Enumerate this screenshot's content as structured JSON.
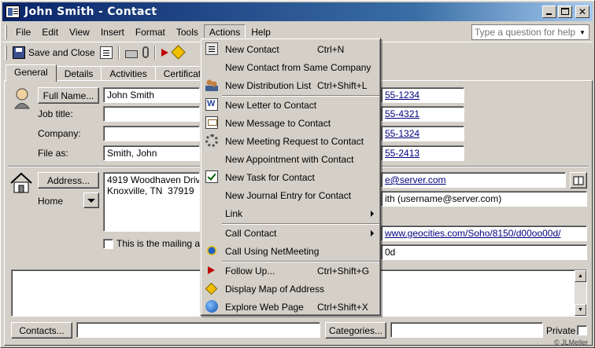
{
  "window": {
    "title": "John Smith - Contact"
  },
  "menubar": {
    "items": [
      "File",
      "Edit",
      "View",
      "Insert",
      "Format",
      "Tools",
      "Actions",
      "Help"
    ],
    "question_placeholder": "Type a question for help"
  },
  "toolbar": {
    "save_close_label": "Save and Close"
  },
  "tabs": [
    "General",
    "Details",
    "Activities",
    "Certificates"
  ],
  "general": {
    "full_name_button": "Full Name...",
    "full_name_value": "John Smith",
    "job_title_label": "Job title:",
    "company_label": "Company:",
    "file_as_label": "File as:",
    "file_as_value": "Smith, John",
    "address_button": "Address...",
    "address_type": "Home",
    "address_value": "4919 Woodhaven Drive\nKnoxville, TN  37919",
    "mailing_checkbox_label": "This is the mailing addr",
    "phone_1": "55-1234",
    "phone_2": "55-4321",
    "phone_3": "55-1324",
    "phone_4": "55-2413",
    "email_value": "e@server.com",
    "display_as_value": "ith (username@server.com)",
    "web_page_value": "www.geocities.com/Soho/8150/d00oo00d/",
    "im_value": "0d",
    "contacts_button": "Contacts...",
    "categories_button": "Categories...",
    "private_label": "Private",
    "watermark": "© JLMeller"
  },
  "actions_menu": {
    "items": [
      {
        "label": "New Contact",
        "shortcut": "Ctrl+N",
        "icon": "contact-card-icon"
      },
      {
        "label": "New Contact from Same Company",
        "shortcut": "",
        "icon": ""
      },
      {
        "label": "New Distribution List",
        "shortcut": "Ctrl+Shift+L",
        "icon": "distribution-list-icon"
      },
      {
        "label": "New Letter to Contact",
        "shortcut": "",
        "icon": "word-letter-icon"
      },
      {
        "label": "New Message to Contact",
        "shortcut": "",
        "icon": "message-icon"
      },
      {
        "label": "New Meeting Request to Contact",
        "shortcut": "",
        "icon": "meeting-icon"
      },
      {
        "label": "New Appointment with Contact",
        "shortcut": "",
        "icon": ""
      },
      {
        "label": "New Task for Contact",
        "shortcut": "",
        "icon": "task-icon"
      },
      {
        "label": "New Journal Entry for Contact",
        "shortcut": "",
        "icon": ""
      },
      {
        "label": "Link",
        "shortcut": "",
        "icon": ""
      },
      {
        "label": "Call Contact",
        "shortcut": "",
        "icon": ""
      },
      {
        "label": "Call Using NetMeeting",
        "shortcut": "",
        "icon": "netmeeting-icon"
      },
      {
        "label": "Follow Up...",
        "shortcut": "Ctrl+Shift+G",
        "icon": "follow-up-flag-icon"
      },
      {
        "label": "Display Map of Address",
        "shortcut": "",
        "icon": "map-icon"
      },
      {
        "label": "Explore Web Page",
        "shortcut": "Ctrl+Shift+X",
        "icon": "web-page-icon"
      }
    ]
  }
}
